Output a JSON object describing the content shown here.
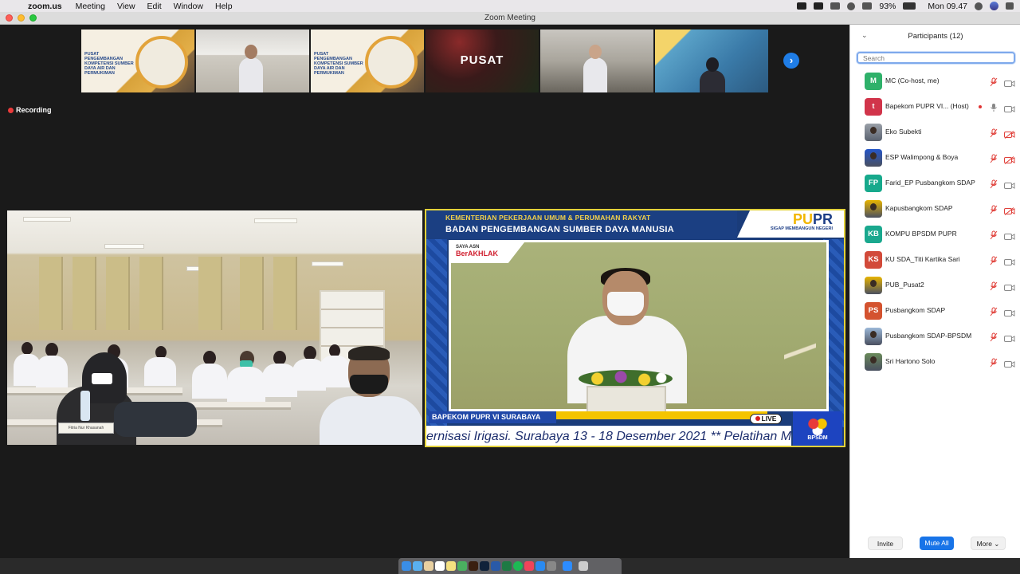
{
  "menubar": {
    "app": "zoom.us",
    "items": [
      "Meeting",
      "View",
      "Edit",
      "Window",
      "Help"
    ],
    "battery": "93%",
    "time": "Mon 09.47"
  },
  "window": {
    "title": "Zoom Meeting"
  },
  "video": {
    "recording_label": "Recording",
    "thumbnails": [
      {
        "text": "PUSAT PENGEMBANGAN KOMPETENSI SUMBER DAYA AIR DAN PERMUKIMAN"
      },
      {
        "text": ""
      },
      {
        "text": "PUSAT PENGEMBANGAN KOMPETENSI SUMBER DAYA AIR DAN PERMUKIMAN"
      },
      {
        "text": "PUSAT"
      },
      {
        "text": ""
      },
      {
        "text": ""
      }
    ],
    "right_video": {
      "header_line1": "KEMENTERIAN PEKERJAAN UMUM & PERUMAHAN RAKYAT",
      "header_line2": "BADAN PENGEMBANGAN SUMBER DAYA MANUSIA",
      "logo_pu": "PU",
      "logo_pr": "PR",
      "logo_tagline": "SIGAP MEMBANGUN NEGERI",
      "banner_line1": "SAYA ASN",
      "banner_line2": "BerAKHLAK",
      "chyron": "BAPEKOM PUPR VI SURABAYA",
      "live": "LIVE",
      "ticker": "ernisasi Irigasi. Surabaya 13 - 18 Desember 2021 ** Pelatihan M",
      "corner_logo": "BPSDM"
    },
    "left_video": {
      "nameplate": "Fitria Nur Khasanah"
    }
  },
  "participants": {
    "title": "Participants (12)",
    "search_placeholder": "Search",
    "list": [
      {
        "initials": "M",
        "name": "MC (Co-host, me)",
        "color": "#2fb16a",
        "mic": "muted",
        "cam": "on"
      },
      {
        "initials": "t",
        "name": "Bapekom PUPR VI...  (Host)",
        "color": "#d1344a",
        "mic": "on",
        "cam": "on",
        "host_dot": true
      },
      {
        "initials": "",
        "name": "Eko Subekti",
        "color": "",
        "photo": true,
        "mic": "muted",
        "cam": "off"
      },
      {
        "initials": "",
        "name": "ESP Walimpong & Boya",
        "color": "#2456c9",
        "photo": true,
        "mic": "muted",
        "cam": "off"
      },
      {
        "initials": "FP",
        "name": "Farid_EP Pusbangkom SDAP",
        "color": "#17a98c",
        "mic": "muted",
        "cam": "on"
      },
      {
        "initials": "",
        "name": "Kapusbangkom SDAP",
        "color": "#e8b400",
        "photo": true,
        "mic": "muted",
        "cam": "off"
      },
      {
        "initials": "KB",
        "name": "KOMPU BPSDM PUPR",
        "color": "#1aa88e",
        "mic": "muted",
        "cam": "on"
      },
      {
        "initials": "KS",
        "name": "KU SDA_Titi Kartika Sari",
        "color": "#d24a3a",
        "mic": "muted",
        "cam": "on"
      },
      {
        "initials": "",
        "name": "PUB_Pusat2",
        "color": "#e8b400",
        "photo": true,
        "mic": "muted",
        "cam": "on"
      },
      {
        "initials": "PS",
        "name": "Pusbangkom SDAP",
        "color": "#d4532f",
        "mic": "muted",
        "cam": "on"
      },
      {
        "initials": "",
        "name": "Pusbangkom SDAP-BPSDM",
        "color": "#9bb8d8",
        "photo": true,
        "mic": "muted",
        "cam": "on"
      },
      {
        "initials": "",
        "name": "Sri Hartono Solo",
        "color": "#6a8a5a",
        "photo": true,
        "mic": "muted",
        "cam": "on"
      }
    ],
    "invite": "Invite",
    "mute_all": "Mute All",
    "more": "More"
  }
}
